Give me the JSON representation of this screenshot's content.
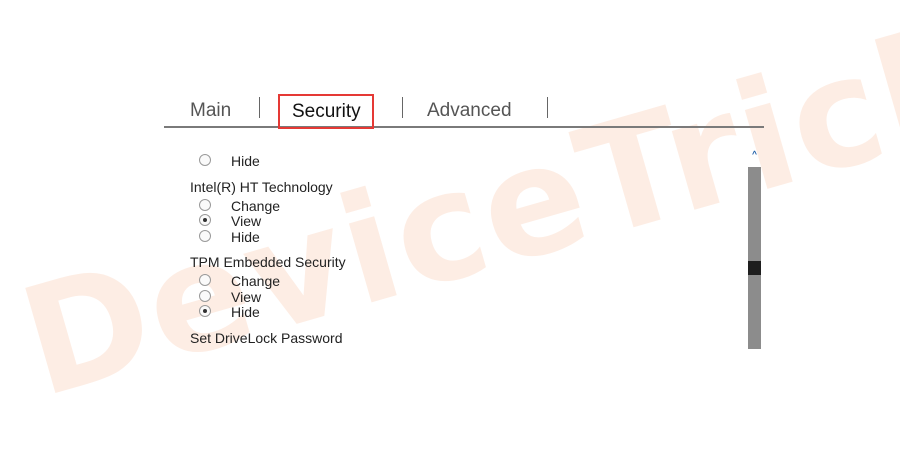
{
  "watermark": "DeviceTricks",
  "tabs": [
    {
      "label": "Main",
      "active": false
    },
    {
      "label": "Security",
      "active": true
    },
    {
      "label": "Advanced",
      "active": false
    }
  ],
  "content": {
    "top_option": {
      "label": "Hide",
      "checked": false
    },
    "groups": [
      {
        "title": "Intel(R) HT Technology",
        "options": [
          {
            "label": "Change",
            "checked": false
          },
          {
            "label": "View",
            "checked": true
          },
          {
            "label": "Hide",
            "checked": false
          }
        ]
      },
      {
        "title": "TPM Embedded Security",
        "options": [
          {
            "label": "Change",
            "checked": false
          },
          {
            "label": "View",
            "checked": false
          },
          {
            "label": "Hide",
            "checked": true
          }
        ]
      },
      {
        "title": "Set DriveLock Password",
        "options": []
      }
    ]
  },
  "scrollbar": {
    "up_arrow_icon": "chevron-up-icon",
    "position_fraction": 0.6,
    "colors": {
      "arrow": "#1f5fa8",
      "track": "#8c8c8c",
      "thumb": "#1e1e1e"
    }
  },
  "colors": {
    "highlight_box": "#e53935",
    "watermark": "#fad7c3"
  }
}
